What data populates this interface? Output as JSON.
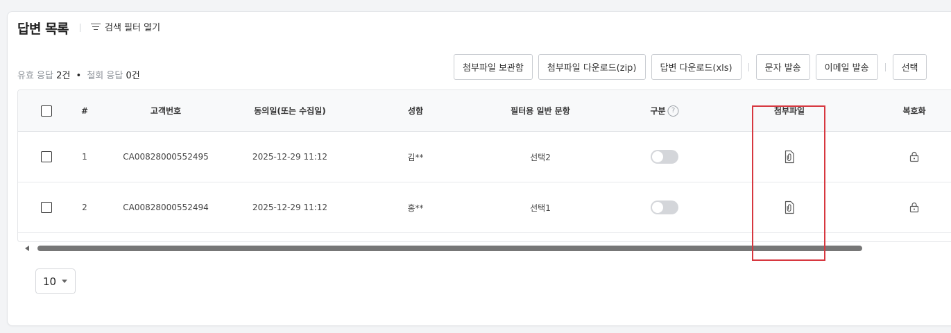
{
  "header": {
    "title": "답변 목록",
    "filter_label": "검색 필터 열기"
  },
  "summary": {
    "valid_label": "유효 응답",
    "valid_count": "2건",
    "dot": "•",
    "withdrawn_label": "철회 응답",
    "withdrawn_count": "0건"
  },
  "toolbar": {
    "buttons": [
      "첨부파일 보관함",
      "첨부파일 다운로드(zip)",
      "답변 다운로드(xls)",
      "문자 발송",
      "이메일 발송",
      "선택"
    ]
  },
  "table": {
    "headers": [
      "#",
      "고객번호",
      "동의일(또는 수집일)",
      "성함",
      "필터용 일반 문항",
      "구분",
      "첨부파일",
      "복호화"
    ],
    "help_glyph": "?",
    "rows": [
      {
        "num": "1",
        "customer_id": "CA00828000552495",
        "date": "2025-12-29 11:12",
        "name": "김**",
        "question": "선택2",
        "toggle_on": false
      },
      {
        "num": "2",
        "customer_id": "CA00828000552494",
        "date": "2025-12-29 11:12",
        "name": "홍**",
        "question": "선택1",
        "toggle_on": false
      }
    ]
  },
  "pagination": {
    "page_size": "10"
  },
  "icons": {
    "filter": "filter-lines-icon",
    "attachment": "paperclip-file-icon",
    "decrypt": "lock-icon",
    "dropdown": "caret-down-icon"
  },
  "colors": {
    "highlight_border": "#d7373f",
    "toggle_off": "#d4d6da",
    "scroll_thumb": "#777777"
  }
}
